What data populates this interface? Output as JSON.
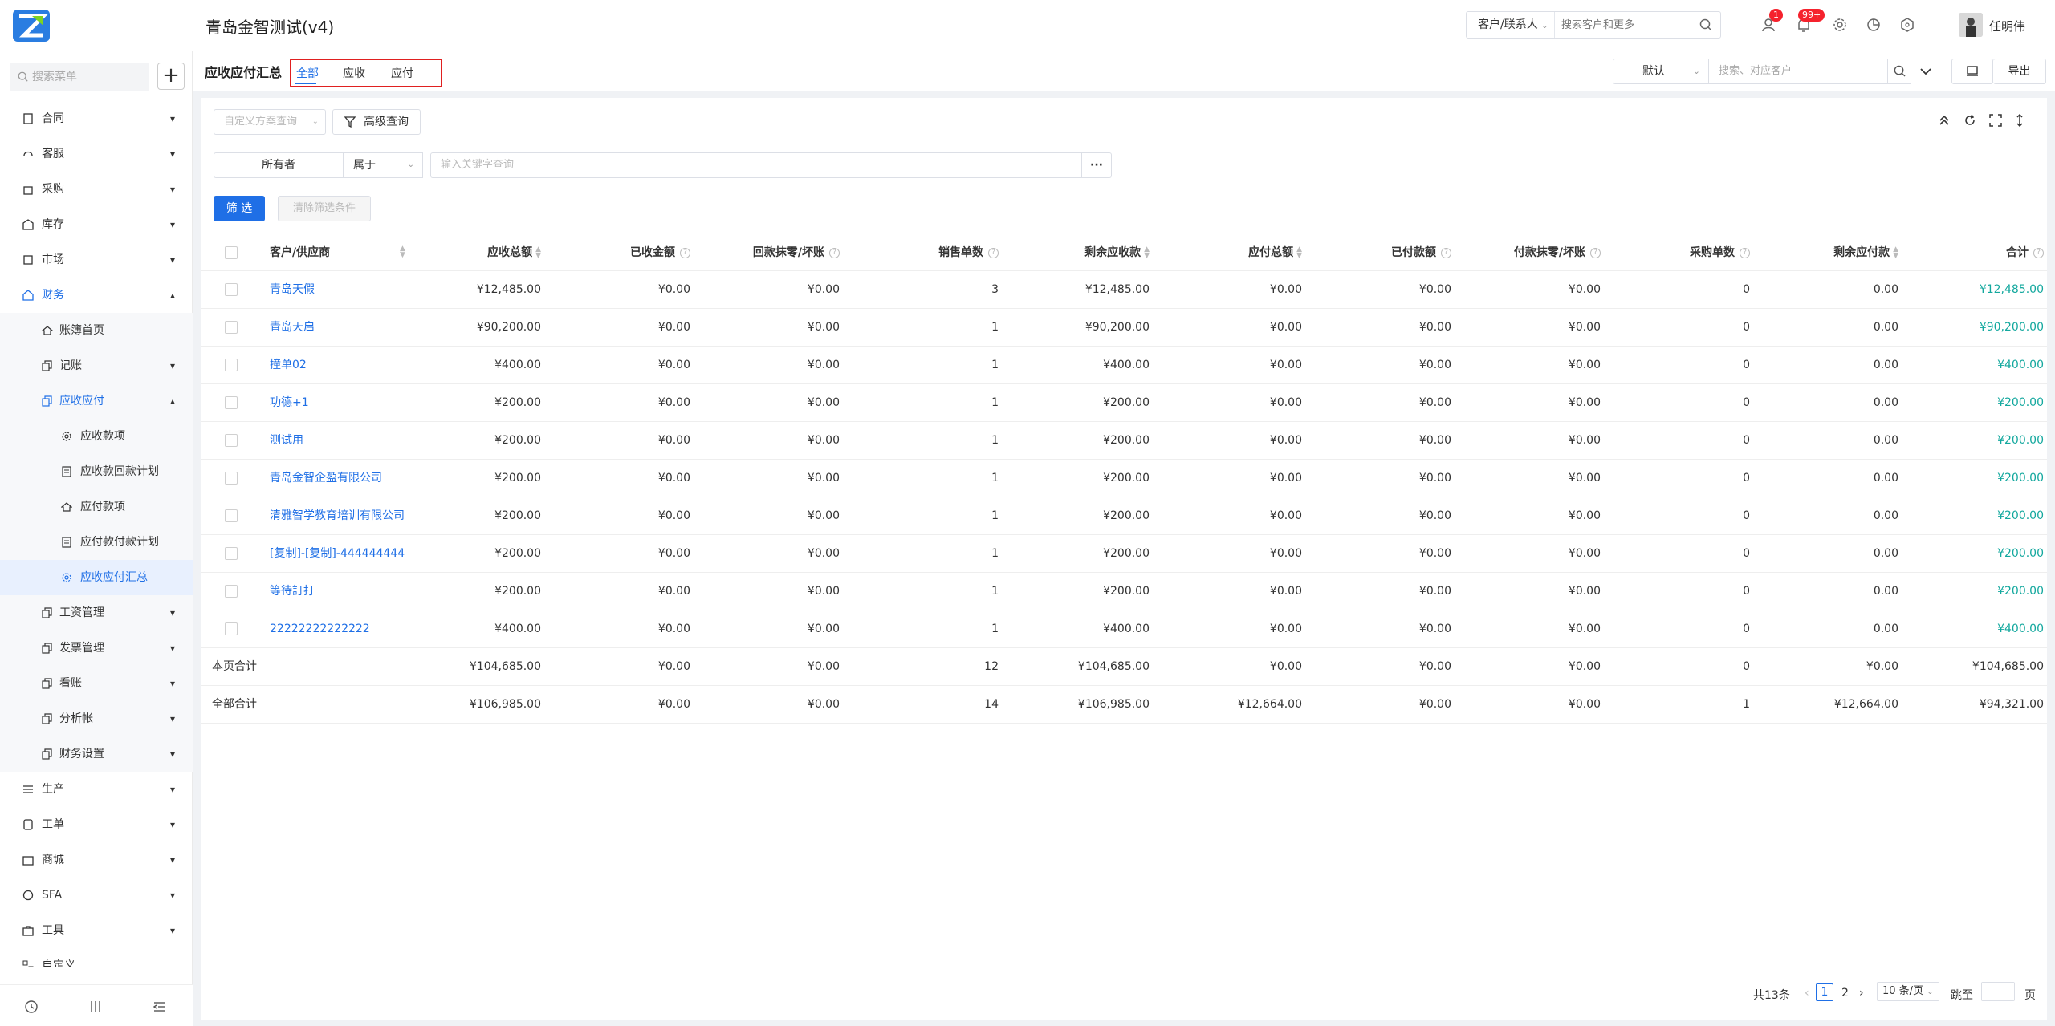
{
  "app": {
    "title": "青岛金智测试(v4)"
  },
  "topbar": {
    "search_type": "客户/联系人",
    "search_placeholder": "搜索客户和更多",
    "badge_contacts": "1",
    "badge_notify": "99+",
    "user_name": "任明伟"
  },
  "sidebar": {
    "search_placeholder": "搜索菜单",
    "plus": "+",
    "items": [
      {
        "label": "合同",
        "icon": "contract-icon"
      },
      {
        "label": "客服",
        "icon": "headset-icon"
      },
      {
        "label": "采购",
        "icon": "bag-icon"
      },
      {
        "label": "库存",
        "icon": "warehouse-icon"
      },
      {
        "label": "市场",
        "icon": "market-icon"
      },
      {
        "label": "财务",
        "icon": "finance-icon"
      },
      {
        "label": "账簿首页",
        "icon": "home-icon"
      },
      {
        "label": "记账",
        "icon": "copy-icon"
      },
      {
        "label": "应收应付",
        "icon": "copy-icon"
      },
      {
        "label": "应收款项",
        "icon": "gear-icon"
      },
      {
        "label": "应收款回款计划",
        "icon": "doc-icon"
      },
      {
        "label": "应付款项",
        "icon": "home-icon"
      },
      {
        "label": "应付款付款计划",
        "icon": "doc-icon"
      },
      {
        "label": "应收应付汇总",
        "icon": "gear-icon"
      },
      {
        "label": "工资管理",
        "icon": "copy-icon"
      },
      {
        "label": "发票管理",
        "icon": "copy-icon"
      },
      {
        "label": "看账",
        "icon": "copy-icon"
      },
      {
        "label": "分析帐",
        "icon": "copy-icon"
      },
      {
        "label": "财务设置",
        "icon": "copy-icon"
      },
      {
        "label": "生产",
        "icon": "production-icon"
      },
      {
        "label": "工单",
        "icon": "ticket-icon"
      },
      {
        "label": "商城",
        "icon": "store-icon"
      },
      {
        "label": "SFA",
        "icon": "sfa-icon"
      },
      {
        "label": "工具",
        "icon": "toolbox-icon"
      },
      {
        "label": "自定义",
        "icon": "custom-icon"
      }
    ]
  },
  "header": {
    "page_title": "应收应付汇总",
    "tabs": [
      "全部",
      "应收",
      "应付"
    ],
    "view_select": "默认",
    "search_placeholder": "搜索、对应客户",
    "export": "导出"
  },
  "filters": {
    "custom_scheme_placeholder": "自定义方案查询",
    "advanced": "高级查询",
    "field": "所有者",
    "operator": "属于",
    "keyword_placeholder": "输入关键字查询",
    "more": "···",
    "filter_btn": "筛 选",
    "clear_btn": "清除筛选条件"
  },
  "table": {
    "columns": [
      "客户/供应商",
      "应收总额",
      "已收金额",
      "回款抹零/坏账",
      "销售单数",
      "剩余应收款",
      "应付总额",
      "已付款额",
      "付款抹零/坏账",
      "采购单数",
      "剩余应付款",
      "合计"
    ],
    "rows": [
      [
        "青岛天假",
        "¥12,485.00",
        "¥0.00",
        "¥0.00",
        "3",
        "¥12,485.00",
        "¥0.00",
        "¥0.00",
        "¥0.00",
        "0",
        "0.00",
        "¥12,485.00"
      ],
      [
        "青岛天启",
        "¥90,200.00",
        "¥0.00",
        "¥0.00",
        "1",
        "¥90,200.00",
        "¥0.00",
        "¥0.00",
        "¥0.00",
        "0",
        "0.00",
        "¥90,200.00"
      ],
      [
        "撞单02",
        "¥400.00",
        "¥0.00",
        "¥0.00",
        "1",
        "¥400.00",
        "¥0.00",
        "¥0.00",
        "¥0.00",
        "0",
        "0.00",
        "¥400.00"
      ],
      [
        "功德+1",
        "¥200.00",
        "¥0.00",
        "¥0.00",
        "1",
        "¥200.00",
        "¥0.00",
        "¥0.00",
        "¥0.00",
        "0",
        "0.00",
        "¥200.00"
      ],
      [
        "测试用",
        "¥200.00",
        "¥0.00",
        "¥0.00",
        "1",
        "¥200.00",
        "¥0.00",
        "¥0.00",
        "¥0.00",
        "0",
        "0.00",
        "¥200.00"
      ],
      [
        "青岛金智企盈有限公司",
        "¥200.00",
        "¥0.00",
        "¥0.00",
        "1",
        "¥200.00",
        "¥0.00",
        "¥0.00",
        "¥0.00",
        "0",
        "0.00",
        "¥200.00"
      ],
      [
        "清雅智学教育培训有限公司",
        "¥200.00",
        "¥0.00",
        "¥0.00",
        "1",
        "¥200.00",
        "¥0.00",
        "¥0.00",
        "¥0.00",
        "0",
        "0.00",
        "¥200.00"
      ],
      [
        "[复制]-[复制]-444444444",
        "¥200.00",
        "¥0.00",
        "¥0.00",
        "1",
        "¥200.00",
        "¥0.00",
        "¥0.00",
        "¥0.00",
        "0",
        "0.00",
        "¥200.00"
      ],
      [
        "等待訂打",
        "¥200.00",
        "¥0.00",
        "¥0.00",
        "1",
        "¥200.00",
        "¥0.00",
        "¥0.00",
        "¥0.00",
        "0",
        "0.00",
        "¥200.00"
      ],
      [
        "22222222222222",
        "¥400.00",
        "¥0.00",
        "¥0.00",
        "1",
        "¥400.00",
        "¥0.00",
        "¥0.00",
        "¥0.00",
        "0",
        "0.00",
        "¥400.00"
      ]
    ],
    "page_total": [
      "本页合计",
      "¥104,685.00",
      "¥0.00",
      "¥0.00",
      "12",
      "¥104,685.00",
      "¥0.00",
      "¥0.00",
      "¥0.00",
      "0",
      "¥0.00",
      "¥104,685.00"
    ],
    "all_total": [
      "全部合计",
      "¥106,985.00",
      "¥0.00",
      "¥0.00",
      "14",
      "¥106,985.00",
      "¥12,664.00",
      "¥0.00",
      "¥0.00",
      "1",
      "¥12,664.00",
      "¥94,321.00"
    ]
  },
  "pager": {
    "total": "共13条",
    "pages": [
      "1",
      "2"
    ],
    "page_size": "10 条/页",
    "jump_label": "跳至",
    "page_unit": "页"
  },
  "colors": {
    "accent": "#1f6fe6",
    "total_green": "#13a89e",
    "highlight_red": "#e02020"
  }
}
